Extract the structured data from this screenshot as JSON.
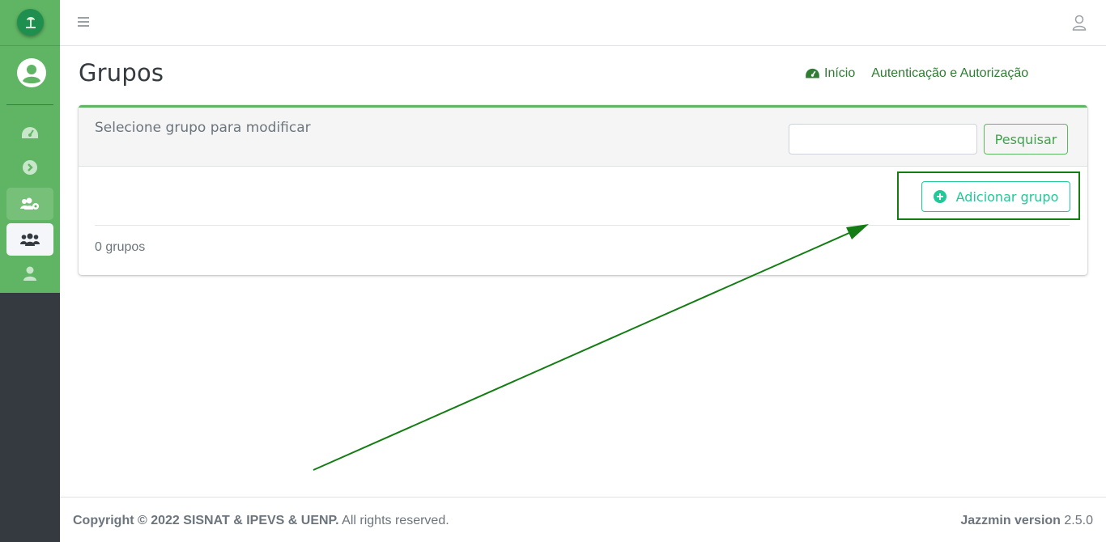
{
  "header": {
    "page_title": "Grupos",
    "breadcrumb": {
      "home": "Início",
      "section": "Autenticação e Autorização"
    }
  },
  "card": {
    "title": "Selecione grupo para modificar",
    "search_value": "",
    "search_button": "Pesquisar",
    "add_button": "Adicionar grupo",
    "count_text": "0 grupos"
  },
  "footer": {
    "copyright": "Copyright © 2022 SISNAT & IPEVS & UENP.",
    "rights": "All rights reserved.",
    "version_label": "Jazzmin version",
    "version_number": "2.5.0"
  },
  "sidebar": {
    "items": [
      {
        "icon": "tachometer-icon"
      },
      {
        "icon": "chevron-circle-right-icon"
      },
      {
        "icon": "users-cog-icon"
      },
      {
        "icon": "users-icon"
      },
      {
        "icon": "user-icon"
      }
    ]
  },
  "colors": {
    "sidebar_green": "#5fb563",
    "sidebar_dark": "#343a40",
    "accent": "#20c997",
    "highlight": "#137d13"
  }
}
